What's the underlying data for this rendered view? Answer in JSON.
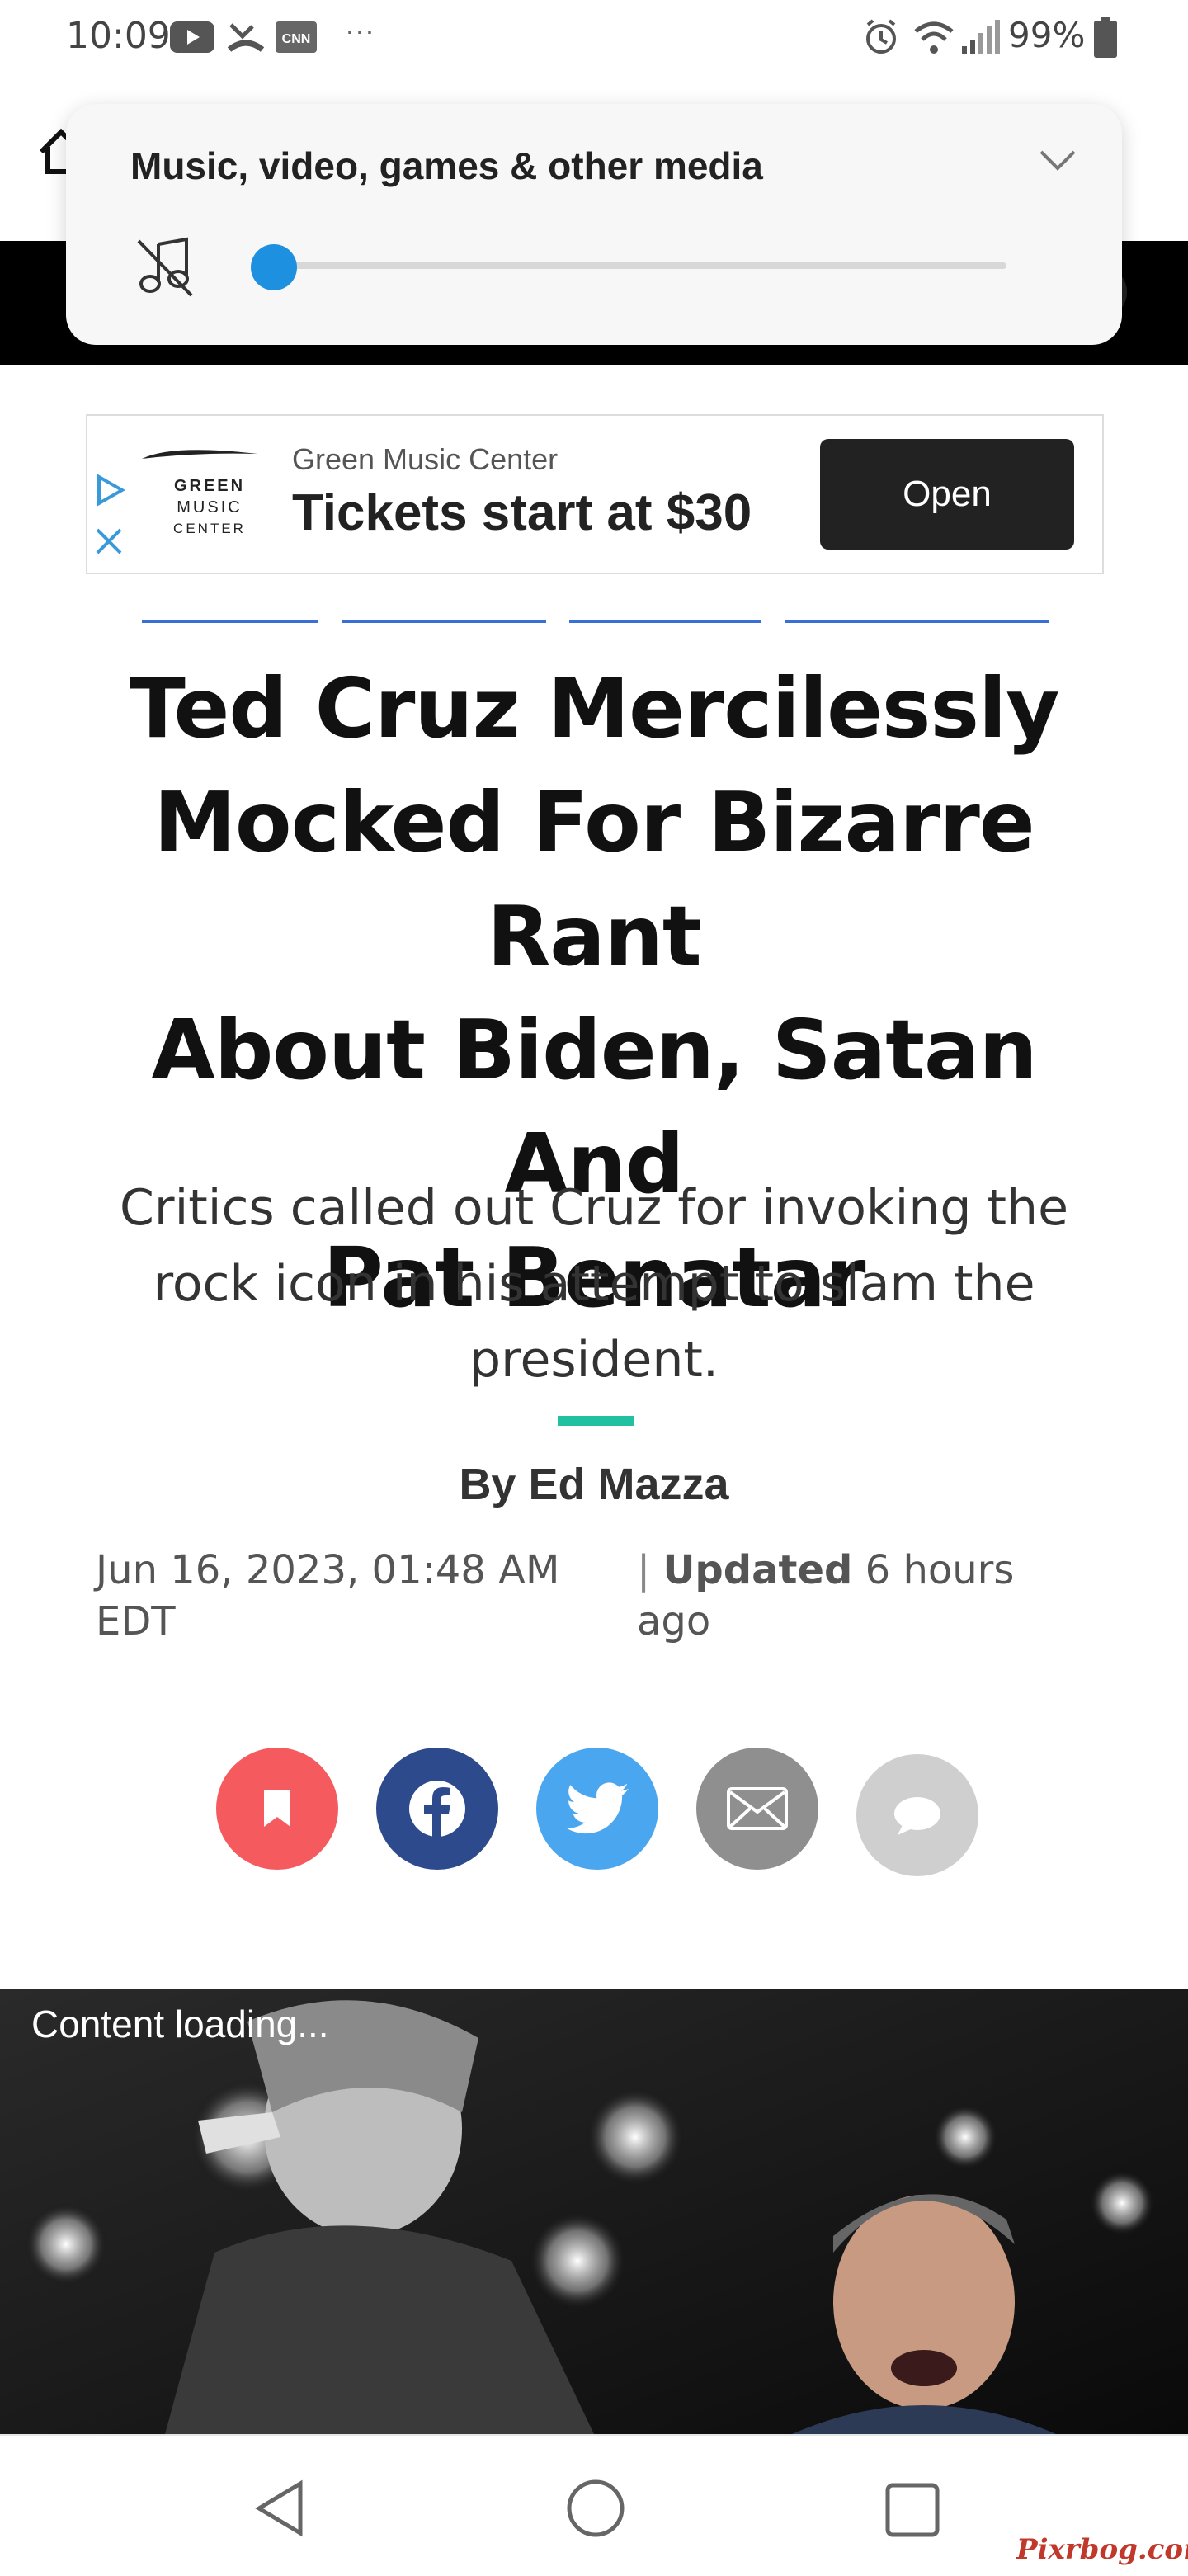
{
  "status_bar": {
    "time": "10:09",
    "battery": "99%",
    "icons": [
      "youtube-icon",
      "missed-call-icon",
      "cnn-icon",
      "more-notifications-icon",
      "alarm-icon",
      "wifi-icon",
      "signal-icon",
      "battery-icon"
    ]
  },
  "volume_panel": {
    "title": "Music, video, games & other media",
    "level": 0.0
  },
  "ad": {
    "logo_lines": [
      "GREEN",
      "MUSIC",
      "CENTER"
    ],
    "advertiser": "Green Music Center",
    "headline": "Tickets start at $30",
    "open_label": "Open"
  },
  "article": {
    "headline_lines": [
      "Ted Cruz Mercilessly",
      "Mocked For Bizarre Rant",
      "About Biden, Satan And",
      "Pat Benatar"
    ],
    "subhead": "Critics called out Cruz for invoking the rock icon in his attempt to slam the president.",
    "byline_prefix": "By",
    "author": "Ed Mazza",
    "date_line1": "Jun 16, 2023, 01:48 AM",
    "date_line2": "EDT",
    "updated_label": "Updated",
    "updated_value_1": "6 hours",
    "updated_value_2": "ago"
  },
  "hero": {
    "loading_text": "Content loading..."
  },
  "watermark": "Pixrbog.com",
  "colors": {
    "slider_accent": "#1e90e0",
    "accent_rule": "#20c0a0",
    "bookmark": "#f55a5e",
    "facebook": "#2d4a8c",
    "twitter": "#4aa6ef",
    "email": "#8f8f8f",
    "comment": "#cfcfcf"
  }
}
